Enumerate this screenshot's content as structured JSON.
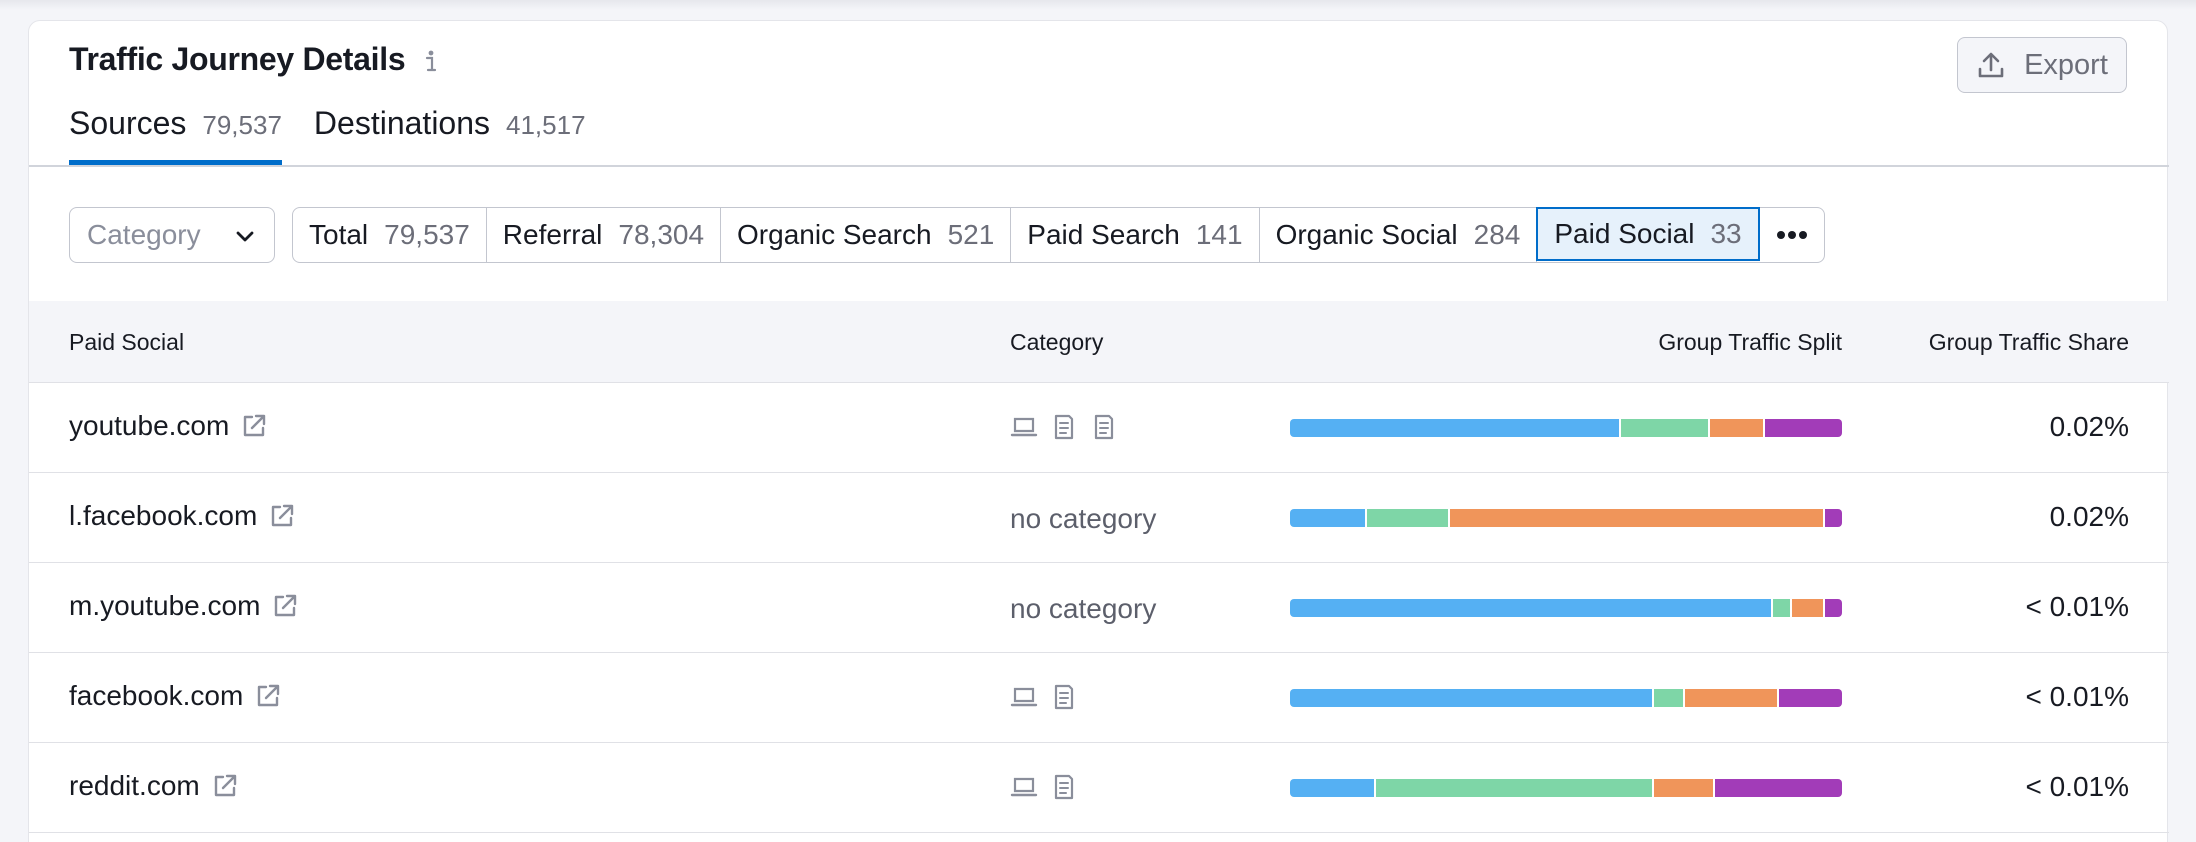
{
  "header": {
    "title": "Traffic Journey Details",
    "info_icon": "info-icon",
    "export_label": "Export",
    "export_icon": "upload-icon"
  },
  "tabs": [
    {
      "label": "Sources",
      "count": "79,537",
      "active": true
    },
    {
      "label": "Destinations",
      "count": "41,517",
      "active": false
    }
  ],
  "filter": {
    "category_placeholder": "Category",
    "segments": [
      {
        "label": "Total",
        "count": "79,537"
      },
      {
        "label": "Referral",
        "count": "78,304"
      },
      {
        "label": "Organic Search",
        "count": "521"
      },
      {
        "label": "Paid Search",
        "count": "141"
      },
      {
        "label": "Organic Social",
        "count": "284"
      },
      {
        "label": "Paid Social",
        "count": "33"
      }
    ],
    "active_segment": "Paid Social",
    "more_icon": "more-dots-icon"
  },
  "table": {
    "columns": {
      "source": "Paid Social",
      "category": "Category",
      "split": "Group Traffic Split",
      "share": "Group Traffic Share"
    },
    "split_colors": {
      "segment_1": "#55b0f3",
      "segment_2": "#7ed6a7",
      "segment_3": "#f0955a",
      "segment_4": "#a23cb8"
    },
    "rows": [
      {
        "domain": "youtube.com",
        "category": "",
        "category_icons": [
          "laptop-icon",
          "document-icon",
          "document-icon"
        ],
        "split": [
          0.6,
          0.16,
          0.1,
          0.14
        ],
        "share": "0.02%"
      },
      {
        "domain": "l.facebook.com",
        "category": "no category",
        "category_icons": [],
        "split": [
          0.14,
          0.15,
          0.68,
          0.03
        ],
        "share": "0.02%"
      },
      {
        "domain": "m.youtube.com",
        "category": "no category",
        "category_icons": [],
        "split": [
          0.875,
          0.035,
          0.06,
          0.03
        ],
        "share": "< 0.01%"
      },
      {
        "domain": "facebook.com",
        "category": "",
        "category_icons": [
          "laptop-icon",
          "document-icon"
        ],
        "split": [
          0.66,
          0.055,
          0.17,
          0.115
        ],
        "share": "< 0.01%"
      },
      {
        "domain": "reddit.com",
        "category": "",
        "category_icons": [
          "laptop-icon",
          "document-icon"
        ],
        "split": [
          0.155,
          0.505,
          0.11,
          0.23
        ],
        "share": "< 0.01%"
      }
    ]
  }
}
